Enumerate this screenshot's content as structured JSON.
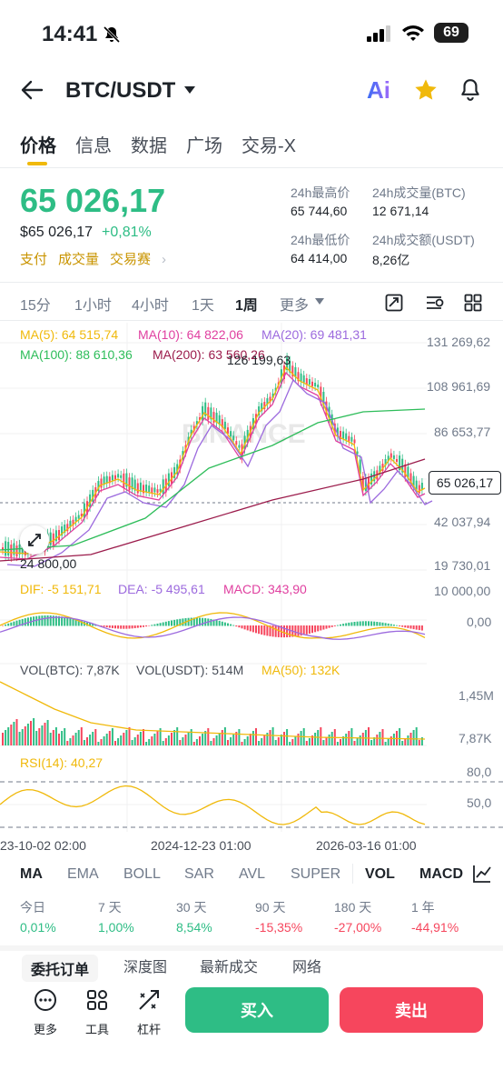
{
  "status_bar": {
    "time": "14:41",
    "battery": "69"
  },
  "header": {
    "pair": "BTC/USDT",
    "ai_label": "Ai"
  },
  "tabs": [
    {
      "label": "价格"
    },
    {
      "label": "信息"
    },
    {
      "label": "数据"
    },
    {
      "label": "广场"
    },
    {
      "label": "交易-X"
    }
  ],
  "price": {
    "last": "65 026,17",
    "fiat": "$65 026,17",
    "change": "+0,81%",
    "links": [
      "支付",
      "成交量",
      "交易赛"
    ]
  },
  "stats": {
    "high_label": "24h最高价",
    "high": "65 744,60",
    "vol_btc_label": "24h成交量(BTC)",
    "vol_btc": "12 671,14",
    "low_label": "24h最低价",
    "low": "64 414,00",
    "vol_usdt_label": "24h成交额(USDT)",
    "vol_usdt": "8,26亿"
  },
  "intervals": [
    "15分",
    "1小时",
    "4小时",
    "1天",
    "1周",
    "更多"
  ],
  "ma_legend": {
    "ma5": "MA(5): 64 515,74",
    "ma10": "MA(10): 64 822,06",
    "ma20": "MA(20): 69 481,31",
    "ma100": "MA(100): 88 610,36",
    "ma200": "MA(200): 63 560,26"
  },
  "price_axis": [
    "131 269,62",
    "108 961,69",
    "86 653,77",
    "65 026,17",
    "42 037,94",
    "19 730,01"
  ],
  "annotations": {
    "high": "126 199,63",
    "low": "24 800,00",
    "watermark": "BINANCE"
  },
  "macd": {
    "dif": "DIF: -5 151,71",
    "dea": "DEA: -5 495,61",
    "macd": "MACD: 343,90",
    "axis": [
      "10 000,00",
      "0,00"
    ]
  },
  "volume": {
    "btc": "VOL(BTC): 7,87K",
    "usdt": "VOL(USDT): 514M",
    "ma50": "MA(50): 132K",
    "axis": [
      "1,45M",
      "7,87K"
    ]
  },
  "rsi": {
    "label": "RSI(14): 40,27",
    "axis": [
      "80,0",
      "50,0"
    ]
  },
  "time_axis": [
    "23-10-02 02:00",
    "2024-12-23 01:00",
    "2026-03-16 01:00"
  ],
  "indicator_tabs": [
    "MA",
    "EMA",
    "BOLL",
    "SAR",
    "AVL",
    "SUPER",
    "VOL",
    "MACD"
  ],
  "performance": [
    {
      "label": "今日",
      "value": "0,01%"
    },
    {
      "label": "7 天",
      "value": "1,00%"
    },
    {
      "label": "30 天",
      "value": "8,54%"
    },
    {
      "label": "90 天",
      "value": "-15,35%"
    },
    {
      "label": "180 天",
      "value": "-27,00%"
    },
    {
      "label": "1 年",
      "value": "-44,91%"
    }
  ],
  "sub_tabs": [
    "委托订单",
    "深度图",
    "最新成交",
    "网络"
  ],
  "bottom_tools": [
    "更多",
    "工具",
    "杠杆"
  ],
  "buttons": {
    "buy": "买入",
    "sell": "卖出"
  },
  "colors": {
    "up": "#2ebd85",
    "down": "#f6465d",
    "accent": "#f0b90b"
  }
}
